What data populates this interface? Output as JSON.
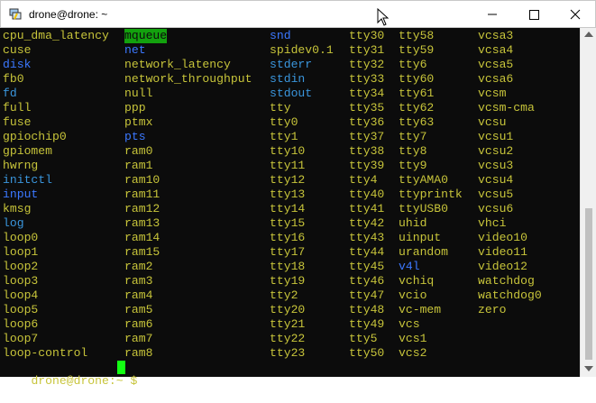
{
  "window": {
    "title": "drone@drone: ~"
  },
  "prompt": {
    "user_host": "drone@drone",
    "path": ":~ ",
    "symbol": "$ "
  },
  "columns": [
    [
      {
        "t": "cpu_dma_latency",
        "c": "yellow"
      },
      {
        "t": "cuse",
        "c": "yellow"
      },
      {
        "t": "disk",
        "c": "blue"
      },
      {
        "t": "fb0",
        "c": "yellow"
      },
      {
        "t": "fd",
        "c": "cyan"
      },
      {
        "t": "full",
        "c": "yellow"
      },
      {
        "t": "fuse",
        "c": "yellow"
      },
      {
        "t": "gpiochip0",
        "c": "yellow"
      },
      {
        "t": "gpiomem",
        "c": "yellow"
      },
      {
        "t": "hwrng",
        "c": "yellow"
      },
      {
        "t": "initctl",
        "c": "cyan"
      },
      {
        "t": "input",
        "c": "blue"
      },
      {
        "t": "kmsg",
        "c": "yellow"
      },
      {
        "t": "log",
        "c": "cyan"
      },
      {
        "t": "loop0",
        "c": "yellow"
      },
      {
        "t": "loop1",
        "c": "yellow"
      },
      {
        "t": "loop2",
        "c": "yellow"
      },
      {
        "t": "loop3",
        "c": "yellow"
      },
      {
        "t": "loop4",
        "c": "yellow"
      },
      {
        "t": "loop5",
        "c": "yellow"
      },
      {
        "t": "loop6",
        "c": "yellow"
      },
      {
        "t": "loop7",
        "c": "yellow"
      },
      {
        "t": "loop-control",
        "c": "yellow"
      }
    ],
    [
      {
        "t": "mqueue",
        "c": "hl"
      },
      {
        "t": "net",
        "c": "blue"
      },
      {
        "t": "network_latency",
        "c": "yellow"
      },
      {
        "t": "network_throughput",
        "c": "yellow"
      },
      {
        "t": "null",
        "c": "yellow"
      },
      {
        "t": "ppp",
        "c": "yellow"
      },
      {
        "t": "ptmx",
        "c": "yellow"
      },
      {
        "t": "pts",
        "c": "blue"
      },
      {
        "t": "ram0",
        "c": "yellow"
      },
      {
        "t": "ram1",
        "c": "yellow"
      },
      {
        "t": "ram10",
        "c": "yellow"
      },
      {
        "t": "ram11",
        "c": "yellow"
      },
      {
        "t": "ram12",
        "c": "yellow"
      },
      {
        "t": "ram13",
        "c": "yellow"
      },
      {
        "t": "ram14",
        "c": "yellow"
      },
      {
        "t": "ram15",
        "c": "yellow"
      },
      {
        "t": "ram2",
        "c": "yellow"
      },
      {
        "t": "ram3",
        "c": "yellow"
      },
      {
        "t": "ram4",
        "c": "yellow"
      },
      {
        "t": "ram5",
        "c": "yellow"
      },
      {
        "t": "ram6",
        "c": "yellow"
      },
      {
        "t": "ram7",
        "c": "yellow"
      },
      {
        "t": "ram8",
        "c": "yellow"
      }
    ],
    [
      {
        "t": "snd",
        "c": "blue"
      },
      {
        "t": "spidev0.1",
        "c": "yellow"
      },
      {
        "t": "stderr",
        "c": "cyan"
      },
      {
        "t": "stdin",
        "c": "cyan"
      },
      {
        "t": "stdout",
        "c": "cyan"
      },
      {
        "t": "tty",
        "c": "yellow"
      },
      {
        "t": "tty0",
        "c": "yellow"
      },
      {
        "t": "tty1",
        "c": "yellow"
      },
      {
        "t": "tty10",
        "c": "yellow"
      },
      {
        "t": "tty11",
        "c": "yellow"
      },
      {
        "t": "tty12",
        "c": "yellow"
      },
      {
        "t": "tty13",
        "c": "yellow"
      },
      {
        "t": "tty14",
        "c": "yellow"
      },
      {
        "t": "tty15",
        "c": "yellow"
      },
      {
        "t": "tty16",
        "c": "yellow"
      },
      {
        "t": "tty17",
        "c": "yellow"
      },
      {
        "t": "tty18",
        "c": "yellow"
      },
      {
        "t": "tty19",
        "c": "yellow"
      },
      {
        "t": "tty2",
        "c": "yellow"
      },
      {
        "t": "tty20",
        "c": "yellow"
      },
      {
        "t": "tty21",
        "c": "yellow"
      },
      {
        "t": "tty22",
        "c": "yellow"
      },
      {
        "t": "tty23",
        "c": "yellow"
      }
    ],
    [
      {
        "t": "tty30",
        "c": "yellow"
      },
      {
        "t": "tty31",
        "c": "yellow"
      },
      {
        "t": "tty32",
        "c": "yellow"
      },
      {
        "t": "tty33",
        "c": "yellow"
      },
      {
        "t": "tty34",
        "c": "yellow"
      },
      {
        "t": "tty35",
        "c": "yellow"
      },
      {
        "t": "tty36",
        "c": "yellow"
      },
      {
        "t": "tty37",
        "c": "yellow"
      },
      {
        "t": "tty38",
        "c": "yellow"
      },
      {
        "t": "tty39",
        "c": "yellow"
      },
      {
        "t": "tty4",
        "c": "yellow"
      },
      {
        "t": "tty40",
        "c": "yellow"
      },
      {
        "t": "tty41",
        "c": "yellow"
      },
      {
        "t": "tty42",
        "c": "yellow"
      },
      {
        "t": "tty43",
        "c": "yellow"
      },
      {
        "t": "tty44",
        "c": "yellow"
      },
      {
        "t": "tty45",
        "c": "yellow"
      },
      {
        "t": "tty46",
        "c": "yellow"
      },
      {
        "t": "tty47",
        "c": "yellow"
      },
      {
        "t": "tty48",
        "c": "yellow"
      },
      {
        "t": "tty49",
        "c": "yellow"
      },
      {
        "t": "tty5",
        "c": "yellow"
      },
      {
        "t": "tty50",
        "c": "yellow"
      }
    ],
    [
      {
        "t": "tty58",
        "c": "yellow"
      },
      {
        "t": "tty59",
        "c": "yellow"
      },
      {
        "t": "tty6",
        "c": "yellow"
      },
      {
        "t": "tty60",
        "c": "yellow"
      },
      {
        "t": "tty61",
        "c": "yellow"
      },
      {
        "t": "tty62",
        "c": "yellow"
      },
      {
        "t": "tty63",
        "c": "yellow"
      },
      {
        "t": "tty7",
        "c": "yellow"
      },
      {
        "t": "tty8",
        "c": "yellow"
      },
      {
        "t": "tty9",
        "c": "yellow"
      },
      {
        "t": "ttyAMA0",
        "c": "yellow"
      },
      {
        "t": "ttyprintk",
        "c": "yellow"
      },
      {
        "t": "ttyUSB0",
        "c": "yellow"
      },
      {
        "t": "uhid",
        "c": "yellow"
      },
      {
        "t": "uinput",
        "c": "yellow"
      },
      {
        "t": "urandom",
        "c": "yellow"
      },
      {
        "t": "v4l",
        "c": "blue"
      },
      {
        "t": "vchiq",
        "c": "yellow"
      },
      {
        "t": "vcio",
        "c": "yellow"
      },
      {
        "t": "vc-mem",
        "c": "yellow"
      },
      {
        "t": "vcs",
        "c": "yellow"
      },
      {
        "t": "vcs1",
        "c": "yellow"
      },
      {
        "t": "vcs2",
        "c": "yellow"
      }
    ],
    [
      {
        "t": "vcsa3",
        "c": "yellow"
      },
      {
        "t": "vcsa4",
        "c": "yellow"
      },
      {
        "t": "vcsa5",
        "c": "yellow"
      },
      {
        "t": "vcsa6",
        "c": "yellow"
      },
      {
        "t": "vcsm",
        "c": "yellow"
      },
      {
        "t": "vcsm-cma",
        "c": "yellow"
      },
      {
        "t": "vcsu",
        "c": "yellow"
      },
      {
        "t": "vcsu1",
        "c": "yellow"
      },
      {
        "t": "vcsu2",
        "c": "yellow"
      },
      {
        "t": "vcsu3",
        "c": "yellow"
      },
      {
        "t": "vcsu4",
        "c": "yellow"
      },
      {
        "t": "vcsu5",
        "c": "yellow"
      },
      {
        "t": "vcsu6",
        "c": "yellow"
      },
      {
        "t": "vhci",
        "c": "yellow"
      },
      {
        "t": "video10",
        "c": "yellow"
      },
      {
        "t": "video11",
        "c": "yellow"
      },
      {
        "t": "video12",
        "c": "yellow"
      },
      {
        "t": "watchdog",
        "c": "yellow"
      },
      {
        "t": "watchdog0",
        "c": "yellow"
      },
      {
        "t": "zero",
        "c": "yellow"
      }
    ]
  ]
}
